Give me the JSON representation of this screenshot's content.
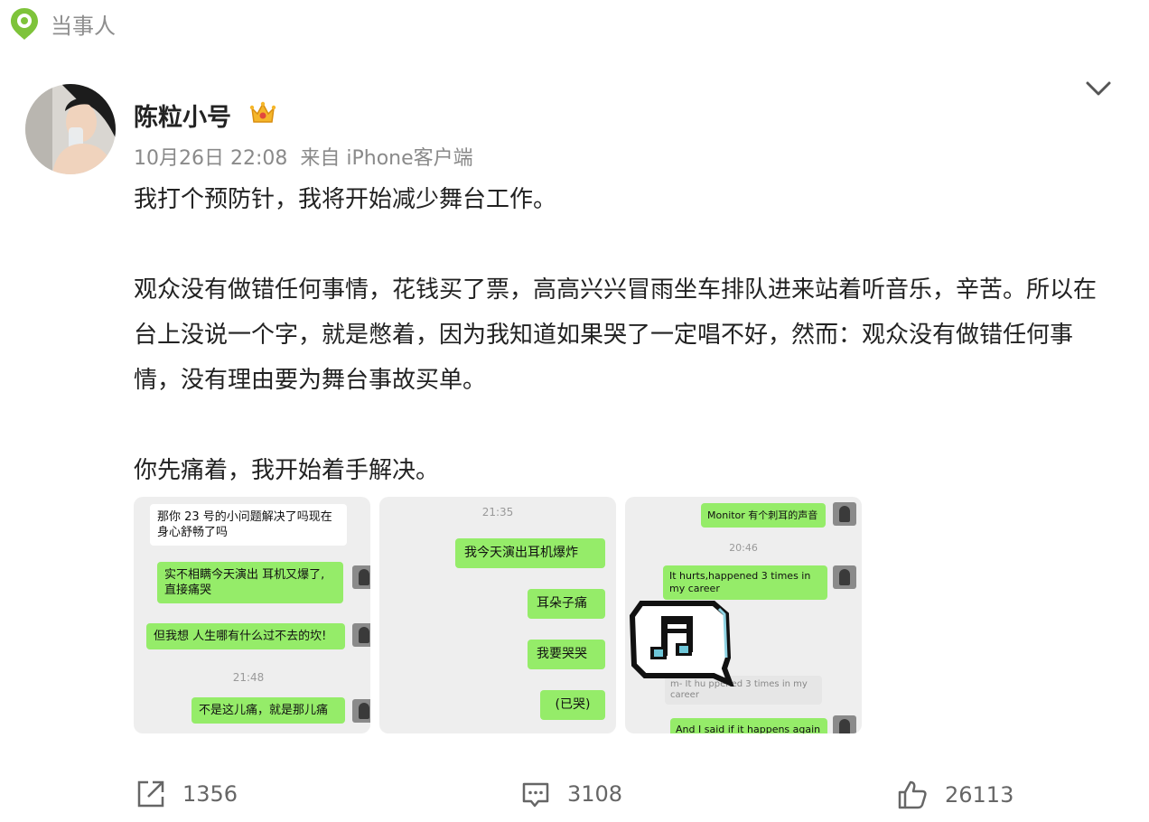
{
  "header": {
    "label": "当事人",
    "icon": "location-pin-icon",
    "icon_color": "#7ec33a"
  },
  "post": {
    "author": "陈粒小号",
    "badge_icon": "crown-icon",
    "time": "10月26日 22:08",
    "source": "来自 iPhone客户端",
    "paragraphs": [
      "我打个预防针，我将开始减少舞台工作。",
      "观众没有做错任何事情，花钱买了票，高高兴兴冒雨坐车排队进来站着听音乐，辛苦。所以在台上没说一个字，就是憋着，因为我知道如果哭了一定唱不好，然而：观众没有做错任何事情，没有理由要为舞台事故买单。",
      "你先痛着，我开始着手解决。"
    ]
  },
  "images": {
    "img1": {
      "msg1": "那你 23 号的小问题解决了吗现在身心舒畅了吗",
      "msg2": "实不相瞒今天演出 耳机又爆了,直接痛哭",
      "msg3": "但我想 人生哪有什么过不去的坎!",
      "time": "21:48",
      "msg4": "不是这儿痛，就是那儿痛"
    },
    "img2": {
      "time": "21:35",
      "msg1": "我今天演出耳机爆炸",
      "msg2": "耳朵子痛",
      "msg3": "我要哭哭",
      "msg4": "(已哭)"
    },
    "img3": {
      "msg1": "Monitor 有个刺耳的声音",
      "time": "20:46",
      "msg2": "It hurts,happened 3 times in my career",
      "quote": "m- It hu  ppened 3 times in my career",
      "msg3": "And I said if it happens again I",
      "sticker_icon": "music-note-icon"
    }
  },
  "actions": {
    "repost_count": "1356",
    "comment_count": "3108",
    "like_count": "26113"
  },
  "colors": {
    "bubble_green": "#95ec69",
    "muted": "#8a8a8a"
  }
}
